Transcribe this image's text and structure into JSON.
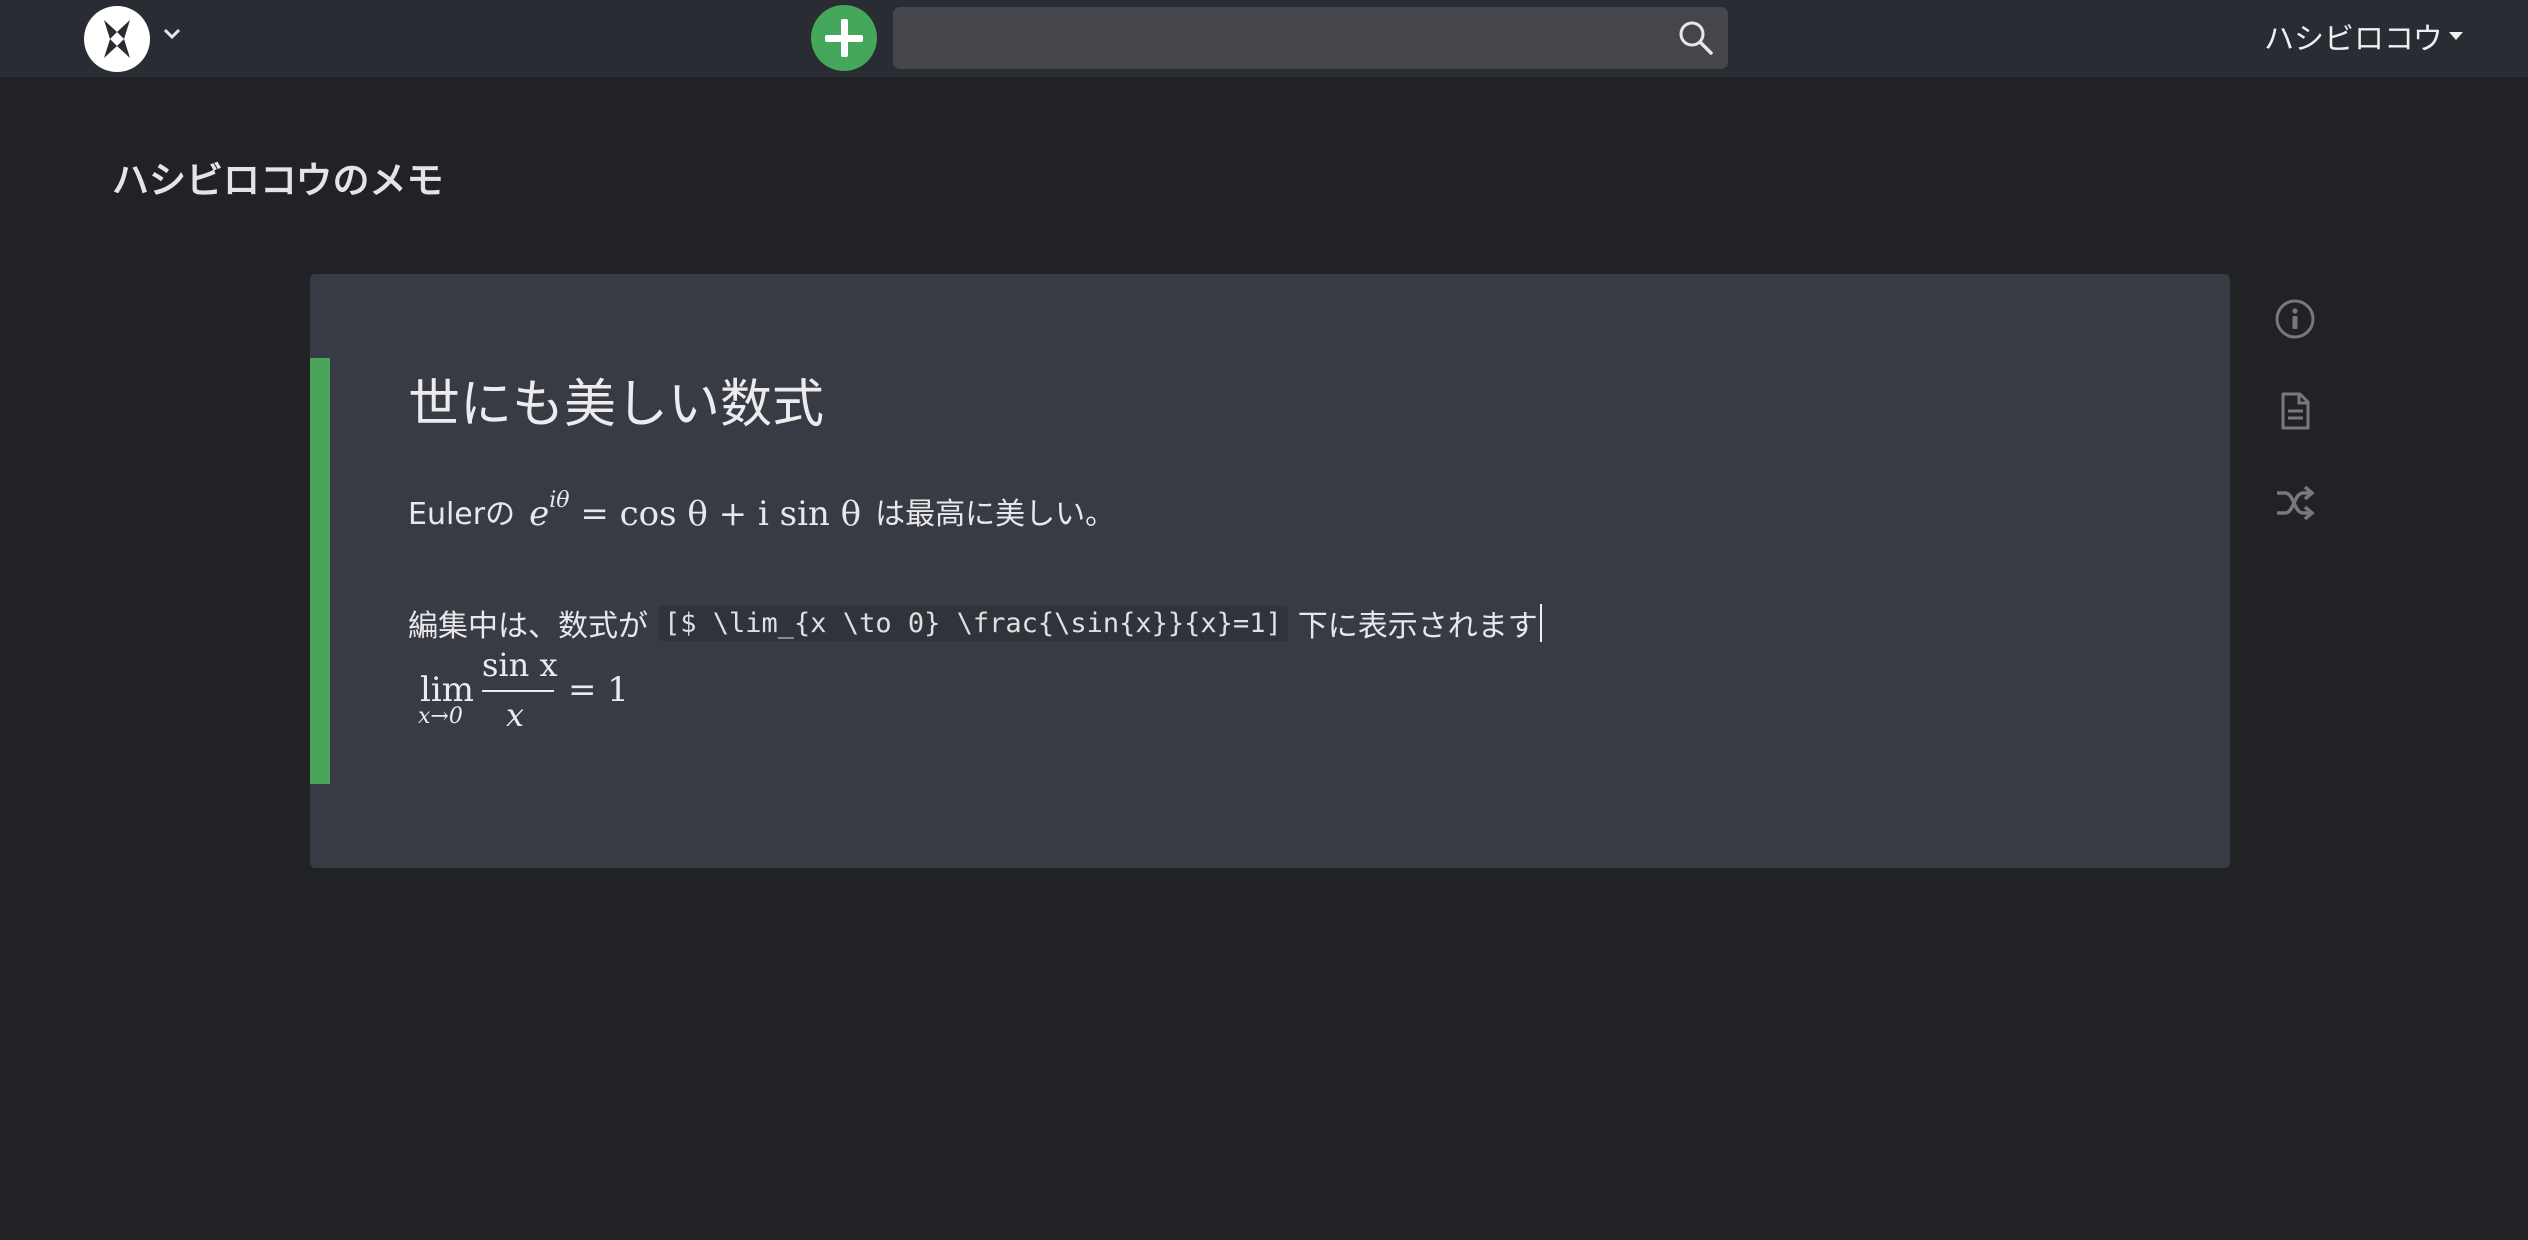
{
  "header": {
    "search_placeholder": "",
    "user_name": "ハシビロコウ",
    "icons": [
      "app-logo-icon",
      "chevron-down-icon",
      "plus-icon",
      "search-icon",
      "caret-down-icon"
    ]
  },
  "site_title": "ハシビロコウのメモ",
  "memo": {
    "title": "世にも美しい数式",
    "line1": {
      "prefix": "Eulerの",
      "math_base": "e",
      "math_exp": "iθ",
      "math_rest": "= cos θ + i sin θ",
      "suffix": "は最高に美しい。"
    },
    "line2": {
      "prefix": "編集中は、数式が",
      "code": "[$ \\lim_{x \\to 0} \\frac{\\sin{x}}{x}=1]",
      "suffix": "下に表示されます"
    },
    "formula": {
      "lim": "lim",
      "sub": "x→0",
      "numerator": "sin x",
      "denominator": "x",
      "rhs": "= 1"
    }
  },
  "sidebar": {
    "icons": [
      "info-icon",
      "document-icon",
      "shuffle-icon"
    ]
  },
  "colors": {
    "background": "#212226",
    "topbar": "#2a2c33",
    "card": "#393b44",
    "accent_green": "#47a45a",
    "search_bg": "#45464b"
  }
}
